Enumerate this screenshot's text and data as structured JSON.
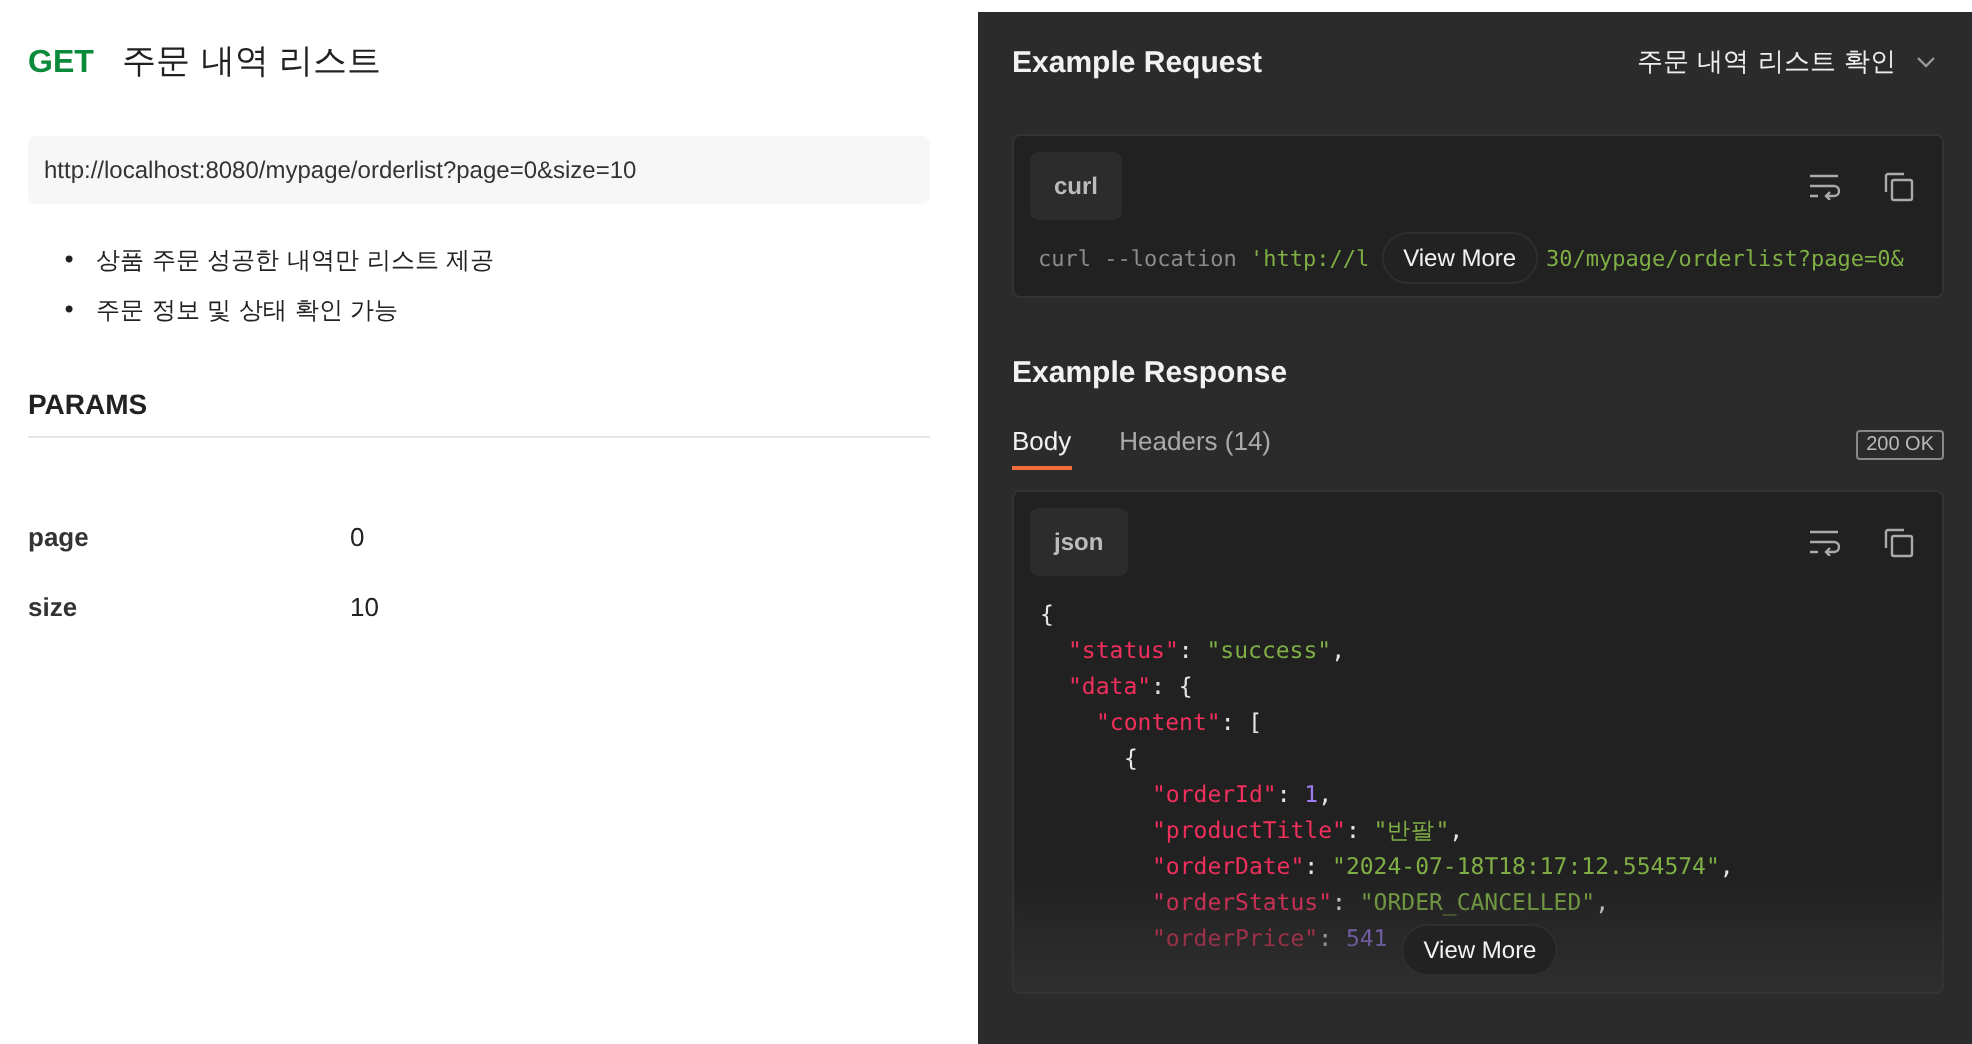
{
  "request": {
    "method": "GET",
    "title": "주문 내역 리스트",
    "url": "http://localhost:8080/mypage/orderlist?page=0&size=10",
    "notes": [
      {
        "bullet": "•",
        "text": "상품 주문 성공한 내역만 리스트 제공"
      },
      {
        "bullet": "•",
        "text": "주문 정보 및 상태 확인 가능"
      }
    ],
    "params_heading": "PARAMS",
    "params": [
      {
        "name": "page",
        "value": "0"
      },
      {
        "name": "size",
        "value": "10"
      }
    ]
  },
  "example_request": {
    "heading": "Example Request",
    "selector": "주문 내역 리스트 확인",
    "language": "curl",
    "line_before": [
      {
        "t": "curl --location ",
        "kind": "plain"
      },
      {
        "t": "'http://l",
        "kind": "str"
      }
    ],
    "line_after": [
      {
        "t": "30/mypage/orderlist?page=0&",
        "kind": "str"
      }
    ],
    "view_more": "View More"
  },
  "example_response": {
    "heading": "Example Response",
    "tabs": [
      {
        "label": "Body",
        "selected": true
      },
      {
        "label": "Headers (14)",
        "selected": false
      }
    ],
    "status": "200 OK",
    "language": "json",
    "view_more": "View More",
    "code": [
      {
        "tokens": [
          {
            "t": "{",
            "kind": "punct"
          }
        ],
        "children": [
          {
            "tokens": [
              {
                "t": "\"status\"",
                "kind": "key"
              },
              {
                "t": ": ",
                "kind": "punct"
              },
              {
                "t": "\"success\"",
                "kind": "str"
              },
              {
                "t": ",",
                "kind": "punct"
              }
            ]
          },
          {
            "tokens": [
              {
                "t": "\"data\"",
                "kind": "key"
              },
              {
                "t": ": {",
                "kind": "punct"
              }
            ],
            "children": [
              {
                "tokens": [
                  {
                    "t": "\"content\"",
                    "kind": "key"
                  },
                  {
                    "t": ": [",
                    "kind": "punct"
                  }
                ],
                "children": [
                  {
                    "tokens": [
                      {
                        "t": "{",
                        "kind": "punct"
                      }
                    ],
                    "children": [
                      {
                        "tokens": [
                          {
                            "t": "\"orderId\"",
                            "kind": "key"
                          },
                          {
                            "t": ": ",
                            "kind": "punct"
                          },
                          {
                            "t": "1",
                            "kind": "num"
                          },
                          {
                            "t": ",",
                            "kind": "punct"
                          }
                        ]
                      },
                      {
                        "tokens": [
                          {
                            "t": "\"productTitle\"",
                            "kind": "key"
                          },
                          {
                            "t": ": ",
                            "kind": "punct"
                          },
                          {
                            "t": "\"반팔\"",
                            "kind": "str"
                          },
                          {
                            "t": ",",
                            "kind": "punct"
                          }
                        ]
                      },
                      {
                        "tokens": [
                          {
                            "t": "\"orderDate\"",
                            "kind": "key"
                          },
                          {
                            "t": ": ",
                            "kind": "punct"
                          },
                          {
                            "t": "\"2024-07-18T18:17:12.554574\"",
                            "kind": "str"
                          },
                          {
                            "t": ",",
                            "kind": "punct"
                          }
                        ]
                      },
                      {
                        "tokens": [
                          {
                            "t": "\"orderStatus\"",
                            "kind": "key"
                          },
                          {
                            "t": ": ",
                            "kind": "punct"
                          },
                          {
                            "t": "\"ORDER_CANCELLED\"",
                            "kind": "str"
                          },
                          {
                            "t": ",",
                            "kind": "punct"
                          }
                        ]
                      },
                      {
                        "tokens": [
                          {
                            "t": "\"orderPrice\"",
                            "kind": "key"
                          },
                          {
                            "t": ": ",
                            "kind": "punct"
                          },
                          {
                            "t": "541",
                            "kind": "num"
                          }
                        ]
                      }
                    ]
                  }
                ]
              }
            ]
          }
        ]
      }
    ]
  }
}
